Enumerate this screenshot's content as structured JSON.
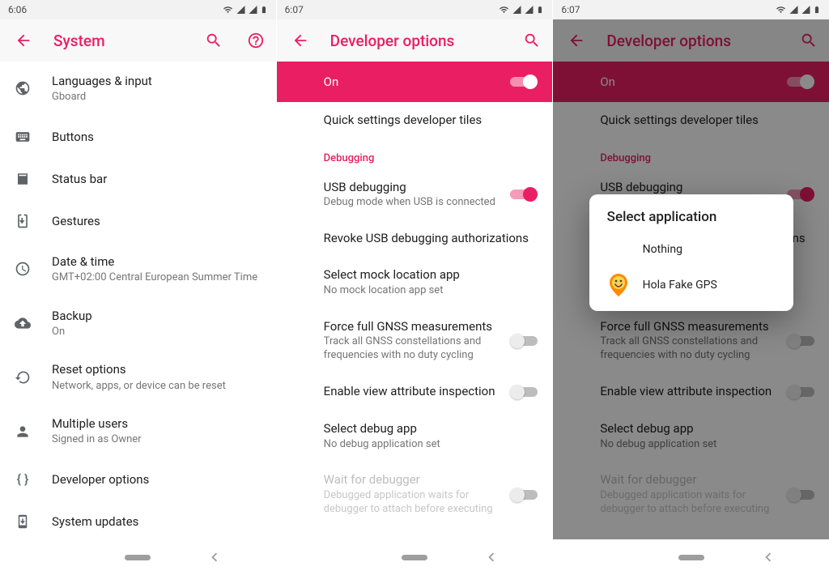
{
  "accent": "#e91e63",
  "phone1": {
    "time": "6:06",
    "title": "System",
    "items": [
      {
        "icon": "globe",
        "label": "Languages & input",
        "sub": "Gboard"
      },
      {
        "icon": "keyboard",
        "label": "Buttons"
      },
      {
        "icon": "statusbar",
        "label": "Status bar"
      },
      {
        "icon": "gestures",
        "label": "Gestures"
      },
      {
        "icon": "clock",
        "label": "Date & time",
        "sub": "GMT+02:00 Central European Summer Time"
      },
      {
        "icon": "cloud",
        "label": "Backup",
        "sub": "On"
      },
      {
        "icon": "reset",
        "label": "Reset options",
        "sub": "Network, apps, or device can be reset"
      },
      {
        "icon": "person",
        "label": "Multiple users",
        "sub": "Signed in as Owner"
      },
      {
        "icon": "braces",
        "label": "Developer options"
      },
      {
        "icon": "update",
        "label": "System updates"
      }
    ]
  },
  "phone2": {
    "time": "6:07",
    "title": "Developer options",
    "master": "On",
    "quickTiles": "Quick settings developer tiles",
    "debugHeader": "Debugging",
    "settings": [
      {
        "label": "USB debugging",
        "sub": "Debug mode when USB is connected",
        "switch": "on"
      },
      {
        "label": "Revoke USB debugging authorizations"
      },
      {
        "label": "Select mock location app",
        "sub": "No mock location app set"
      },
      {
        "label": "Force full GNSS measurements",
        "sub": "Track all GNSS constellations and frequencies with no duty cycling",
        "switch": "off"
      },
      {
        "label": "Enable view attribute inspection",
        "switch": "off"
      },
      {
        "label": "Select debug app",
        "sub": "No debug application set"
      },
      {
        "label": "Wait for debugger",
        "sub": "Debugged application waits for debugger to attach before executing",
        "switch": "off",
        "disabled": true
      }
    ]
  },
  "phone3": {
    "time": "6:07",
    "title": "Developer options",
    "dialogTitle": "Select application",
    "dialogItems": [
      {
        "label": "Nothing",
        "icon": "none"
      },
      {
        "label": "Hola Fake GPS",
        "icon": "smile-pin"
      }
    ]
  }
}
